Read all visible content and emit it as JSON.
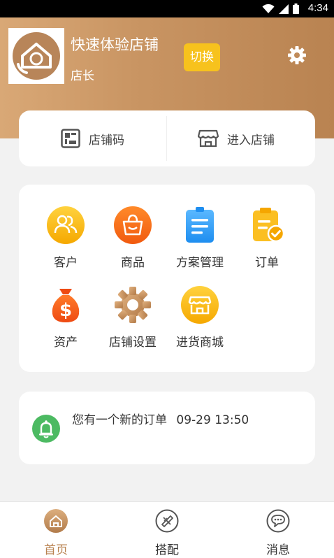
{
  "status_bar": {
    "time": "4:34"
  },
  "header": {
    "shop_name": "快速体验店铺",
    "role": "店长",
    "switch_label": "切换",
    "colors": {
      "gradient_start": "#d9a876",
      "gradient_end": "#b98351",
      "switch_button": "#f7c21d"
    }
  },
  "quick_actions": [
    {
      "label": "店铺码",
      "icon": "qr-code-icon"
    },
    {
      "label": "进入店铺",
      "icon": "storefront-icon"
    }
  ],
  "grid": [
    {
      "label": "客户",
      "icon": "customers-icon"
    },
    {
      "label": "商品",
      "icon": "shopping-bag-icon"
    },
    {
      "label": "方案管理",
      "icon": "document-list-icon"
    },
    {
      "label": "订单",
      "icon": "clipboard-check-icon"
    },
    {
      "label": "资产",
      "icon": "money-bag-icon"
    },
    {
      "label": "店铺设置",
      "icon": "gear-icon"
    },
    {
      "label": "进货商城",
      "icon": "store-icon"
    }
  ],
  "notice": {
    "text": "您有一个新的订单",
    "time": "09-29 13:50",
    "icon": "bell-icon"
  },
  "tabbar": [
    {
      "label": "首页",
      "icon": "home-icon",
      "active": true
    },
    {
      "label": "搭配",
      "icon": "match-icon",
      "active": false
    },
    {
      "label": "消息",
      "icon": "chat-bubble-icon",
      "active": false
    }
  ],
  "colors": {
    "accent": "#b98351",
    "notice_green": "#4cba62"
  }
}
